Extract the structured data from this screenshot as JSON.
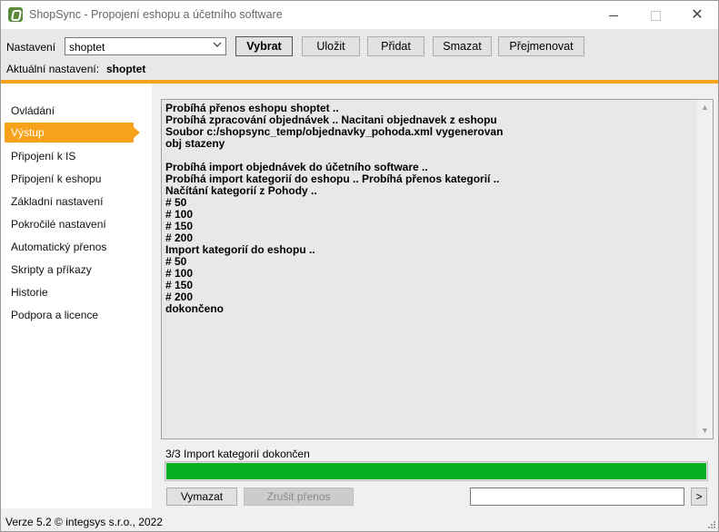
{
  "window": {
    "title": "ShopSync - Propojení eshopu a účetního software",
    "controls": [
      "minimize-icon",
      "maximize-icon",
      "close-icon"
    ]
  },
  "toolbar": {
    "settings_label": "Nastavení",
    "settings_select_value": "shoptet",
    "buttons": {
      "select": "Vybrat",
      "save": "Uložit",
      "add": "Přidat",
      "delete": "Smazat",
      "rename": "Přejmenovat"
    },
    "current_label": "Aktuální nastavení:",
    "current_value": "shoptet"
  },
  "sidebar": {
    "items": [
      {
        "label": "Ovládání"
      },
      {
        "label": "Výstup",
        "active": true
      },
      {
        "label": "Připojení k IS"
      },
      {
        "label": "Připojení k eshopu"
      },
      {
        "label": "Základní nastavení"
      },
      {
        "label": "Pokročilé nastavení"
      },
      {
        "label": "Automatický přenos"
      },
      {
        "label": "Skripty a příkazy"
      },
      {
        "label": "Historie"
      },
      {
        "label": "Podpora a licence"
      }
    ]
  },
  "output": {
    "log": "Probíhá přenos eshopu shoptet ..\nProbíhá zpracování objednávek .. Nacitani objednavek z eshopu\nSoubor c:/shopsync_temp/objednavky_pohoda.xml vygenerovan\nobj stazeny\n\nProbíhá import objednávek do účetního software ..\nProbíhá import kategorií do eshopu .. Probíhá přenos kategorií ..\nNačítání kategorií z Pohody ..\n# 50\n# 100\n# 150\n# 200\nImport kategorií do eshopu ..\n# 50\n# 100\n# 150\n# 200\ndokončeno"
  },
  "status": {
    "text": "3/3 Import kategorií dokončen",
    "progress": 1.0,
    "progress_color": "#06b025"
  },
  "actions": {
    "clear": "Vymazat",
    "cancel_transfer": "Zrušit přenos",
    "command_value": "",
    "go": ">"
  },
  "footer": {
    "text": "Verze 5.2  © integsys s.r.o., 2022"
  },
  "colors": {
    "accent": "#f7a21b"
  }
}
